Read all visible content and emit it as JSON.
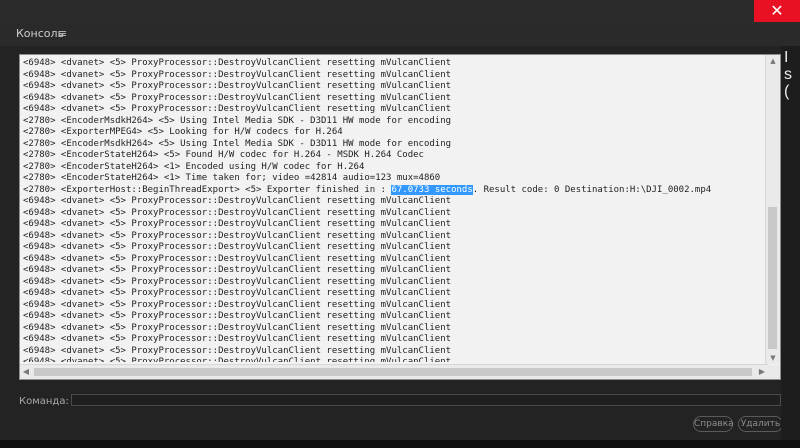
{
  "window": {
    "close_glyph": "✕"
  },
  "panel": {
    "title": "Консоль",
    "menu_glyph": "≡"
  },
  "log": {
    "lines": [
      "<6948> <dvanet> <5> ProxyProcessor::DestroyVulcanClient resetting mVulcanClient",
      "<6948> <dvanet> <5> ProxyProcessor::DestroyVulcanClient resetting mVulcanClient",
      "<6948> <dvanet> <5> ProxyProcessor::DestroyVulcanClient resetting mVulcanClient",
      "<6948> <dvanet> <5> ProxyProcessor::DestroyVulcanClient resetting mVulcanClient",
      "<6948> <dvanet> <5> ProxyProcessor::DestroyVulcanClient resetting mVulcanClient",
      "<2780> <EncoderMsdkH264> <5> Using Intel Media SDK - D3D11 HW mode for encoding",
      "<2780> <ExporterMPEG4> <5> Looking for H/W codecs for H.264",
      "<2780> <EncoderMsdkH264> <5> Using Intel Media SDK - D3D11 HW mode for encoding",
      "<2780> <EncoderStateH264> <5> Found H/W codec for H.264 - MSDK H.264 Codec",
      "<2780> <EncoderStateH264> <1> Encoded using H/W codec for H.264",
      "<2780> <EncoderStateH264> <1> Time taken for; video =42814 audio=123 mux=4860"
    ],
    "export_line": {
      "prefix": "<2780> <ExporterHost::BeginThreadExport> <5> Exporter finished in : ",
      "highlight": "67.0733 seconds",
      "suffix": ". Result code: 0 Destination:H:\\DJI_0002.mp4"
    },
    "tail_lines": [
      "<6948> <dvanet> <5> ProxyProcessor::DestroyVulcanClient resetting mVulcanClient",
      "<6948> <dvanet> <5> ProxyProcessor::DestroyVulcanClient resetting mVulcanClient",
      "<6948> <dvanet> <5> ProxyProcessor::DestroyVulcanClient resetting mVulcanClient",
      "<6948> <dvanet> <5> ProxyProcessor::DestroyVulcanClient resetting mVulcanClient",
      "<6948> <dvanet> <5> ProxyProcessor::DestroyVulcanClient resetting mVulcanClient",
      "<6948> <dvanet> <5> ProxyProcessor::DestroyVulcanClient resetting mVulcanClient",
      "<6948> <dvanet> <5> ProxyProcessor::DestroyVulcanClient resetting mVulcanClient",
      "<6948> <dvanet> <5> ProxyProcessor::DestroyVulcanClient resetting mVulcanClient",
      "<6948> <dvanet> <5> ProxyProcessor::DestroyVulcanClient resetting mVulcanClient",
      "<6948> <dvanet> <5> ProxyProcessor::DestroyVulcanClient resetting mVulcanClient",
      "<6948> <dvanet> <5> ProxyProcessor::DestroyVulcanClient resetting mVulcanClient",
      "<6948> <dvanet> <5> ProxyProcessor::DestroyVulcanClient resetting mVulcanClient",
      "<6948> <dvanet> <5> ProxyProcessor::DestroyVulcanClient resetting mVulcanClient",
      "<6948> <dvanet> <5> ProxyProcessor::DestroyVulcanClient resetting mVulcanClient",
      "<6948> <dvanet> <5> ProxyProcessor::DestroyVulcanClient resetting mVulcanClient"
    ],
    "highlight_color": "#3399ff"
  },
  "command": {
    "label": "Команда:",
    "value": ""
  },
  "buttons": {
    "help": "Справка",
    "clear": "Удалить"
  },
  "background_text": [
    "I",
    "s",
    "("
  ]
}
